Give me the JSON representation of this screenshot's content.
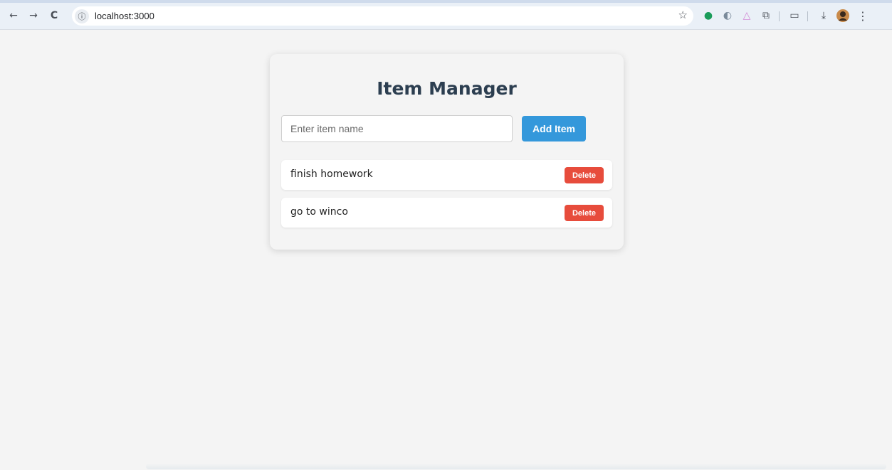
{
  "browser": {
    "url": "localhost:3000",
    "icons": {
      "back": "←",
      "forward": "→",
      "reload": "C",
      "site_info": "ⓘ",
      "bookmark": "☆",
      "extension_1": "●",
      "extension_2": "◐",
      "extension_3": "△",
      "extensions": "⧉",
      "reading": "▭",
      "download": "⤓",
      "menu": "⋮"
    }
  },
  "app": {
    "title": "Item Manager",
    "input_placeholder": "Enter item name",
    "input_value": "",
    "add_label": "Add Item",
    "delete_label": "Delete",
    "items": [
      {
        "name": "finish homework"
      },
      {
        "name": "go to winco"
      }
    ]
  },
  "colors": {
    "title": "#2c3e50",
    "add_button": "#3498db",
    "delete_button": "#e74c3c",
    "page_bg": "#f4f4f4"
  }
}
